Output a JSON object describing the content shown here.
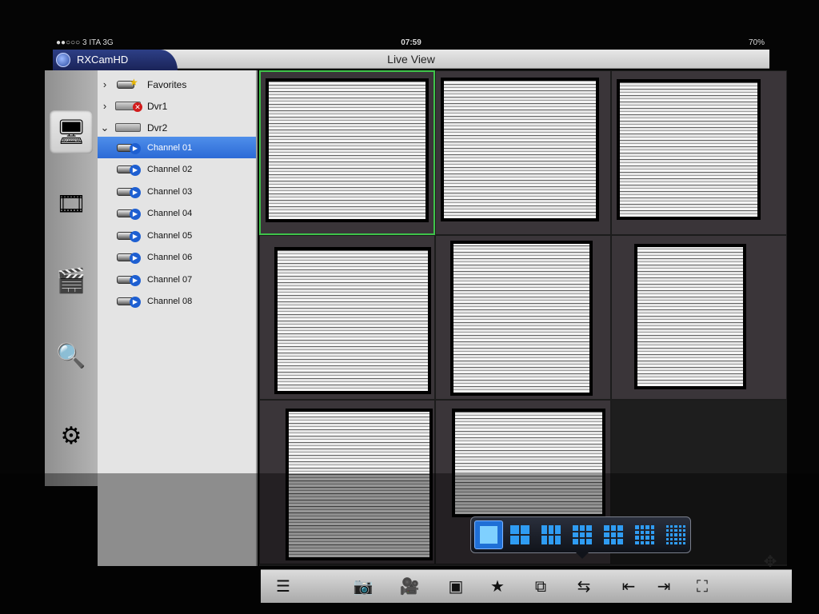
{
  "status_bar": {
    "carrier": "●●○○○ 3 ITA  3G",
    "time": "07:59",
    "battery": "70%"
  },
  "app": {
    "name": "RXCamHD",
    "title": "Live View"
  },
  "nav": [
    {
      "name": "live-view",
      "icon": "monitor-icon",
      "glyph": "🖥",
      "active": true
    },
    {
      "name": "playback",
      "icon": "film-reel-icon",
      "glyph": "🎞",
      "active": false
    },
    {
      "name": "recordings",
      "icon": "clapperboard-icon",
      "glyph": "🎬",
      "active": false
    },
    {
      "name": "search",
      "icon": "magnifier-icon",
      "glyph": "🔍",
      "active": false
    },
    {
      "name": "settings",
      "icon": "gear-icon",
      "glyph": "⚙",
      "active": false
    }
  ],
  "tree": {
    "favorites": "Favorites",
    "dvr1": "Dvr1",
    "dvr2": "Dvr2",
    "channels": [
      "Channel 01",
      "Channel 02",
      "Channel 03",
      "Channel 04",
      "Channel 05",
      "Channel 06",
      "Channel 07",
      "Channel 08"
    ],
    "selected_channel": "Channel 01"
  },
  "layouts": [
    {
      "name": "layout-1",
      "cols": 1,
      "rows": 1,
      "selected": true
    },
    {
      "name": "layout-4",
      "cols": 2,
      "rows": 2,
      "selected": false
    },
    {
      "name": "layout-6",
      "cols": 3,
      "rows": 2,
      "selected": false
    },
    {
      "name": "layout-8",
      "cols": 3,
      "rows": 3,
      "selected": false
    },
    {
      "name": "layout-9",
      "cols": 3,
      "rows": 3,
      "selected": false
    },
    {
      "name": "layout-16",
      "cols": 4,
      "rows": 4,
      "selected": false
    },
    {
      "name": "layout-25",
      "cols": 5,
      "rows": 5,
      "selected": false
    }
  ],
  "toolbar": [
    {
      "name": "stream-list",
      "icon": "list-refresh-icon",
      "glyph": "☰"
    },
    {
      "name": "snapshot",
      "icon": "camera-icon",
      "glyph": "📷"
    },
    {
      "name": "record",
      "icon": "video-camera-icon",
      "glyph": "🎥"
    },
    {
      "name": "screen",
      "icon": "screen-icon",
      "glyph": "▣"
    },
    {
      "name": "favorite",
      "icon": "star-icon",
      "glyph": "★"
    },
    {
      "name": "close-all",
      "icon": "close-windows-icon",
      "glyph": "⧉"
    },
    {
      "name": "layout-switch",
      "icon": "layout-switch-icon",
      "glyph": "⇆"
    },
    {
      "name": "prev-page",
      "icon": "prev-page-icon",
      "glyph": "⇤"
    },
    {
      "name": "next-page",
      "icon": "next-page-icon",
      "glyph": "⇥"
    },
    {
      "name": "fullscreen",
      "icon": "fullscreen-icon",
      "glyph": "⛶"
    }
  ],
  "ptz": {
    "icon": "ptz-joystick-icon",
    "glyph": "✥"
  },
  "tiles": [
    {
      "channel": 1,
      "active": true
    },
    {
      "channel": 2,
      "active": false
    },
    {
      "channel": 3,
      "active": false
    },
    {
      "channel": 4,
      "active": false
    },
    {
      "channel": 5,
      "active": false
    },
    {
      "channel": 6,
      "active": false
    },
    {
      "channel": 7,
      "active": false
    },
    {
      "channel": 8,
      "active": false
    },
    {
      "channel": 9,
      "active": false,
      "empty": true
    }
  ]
}
